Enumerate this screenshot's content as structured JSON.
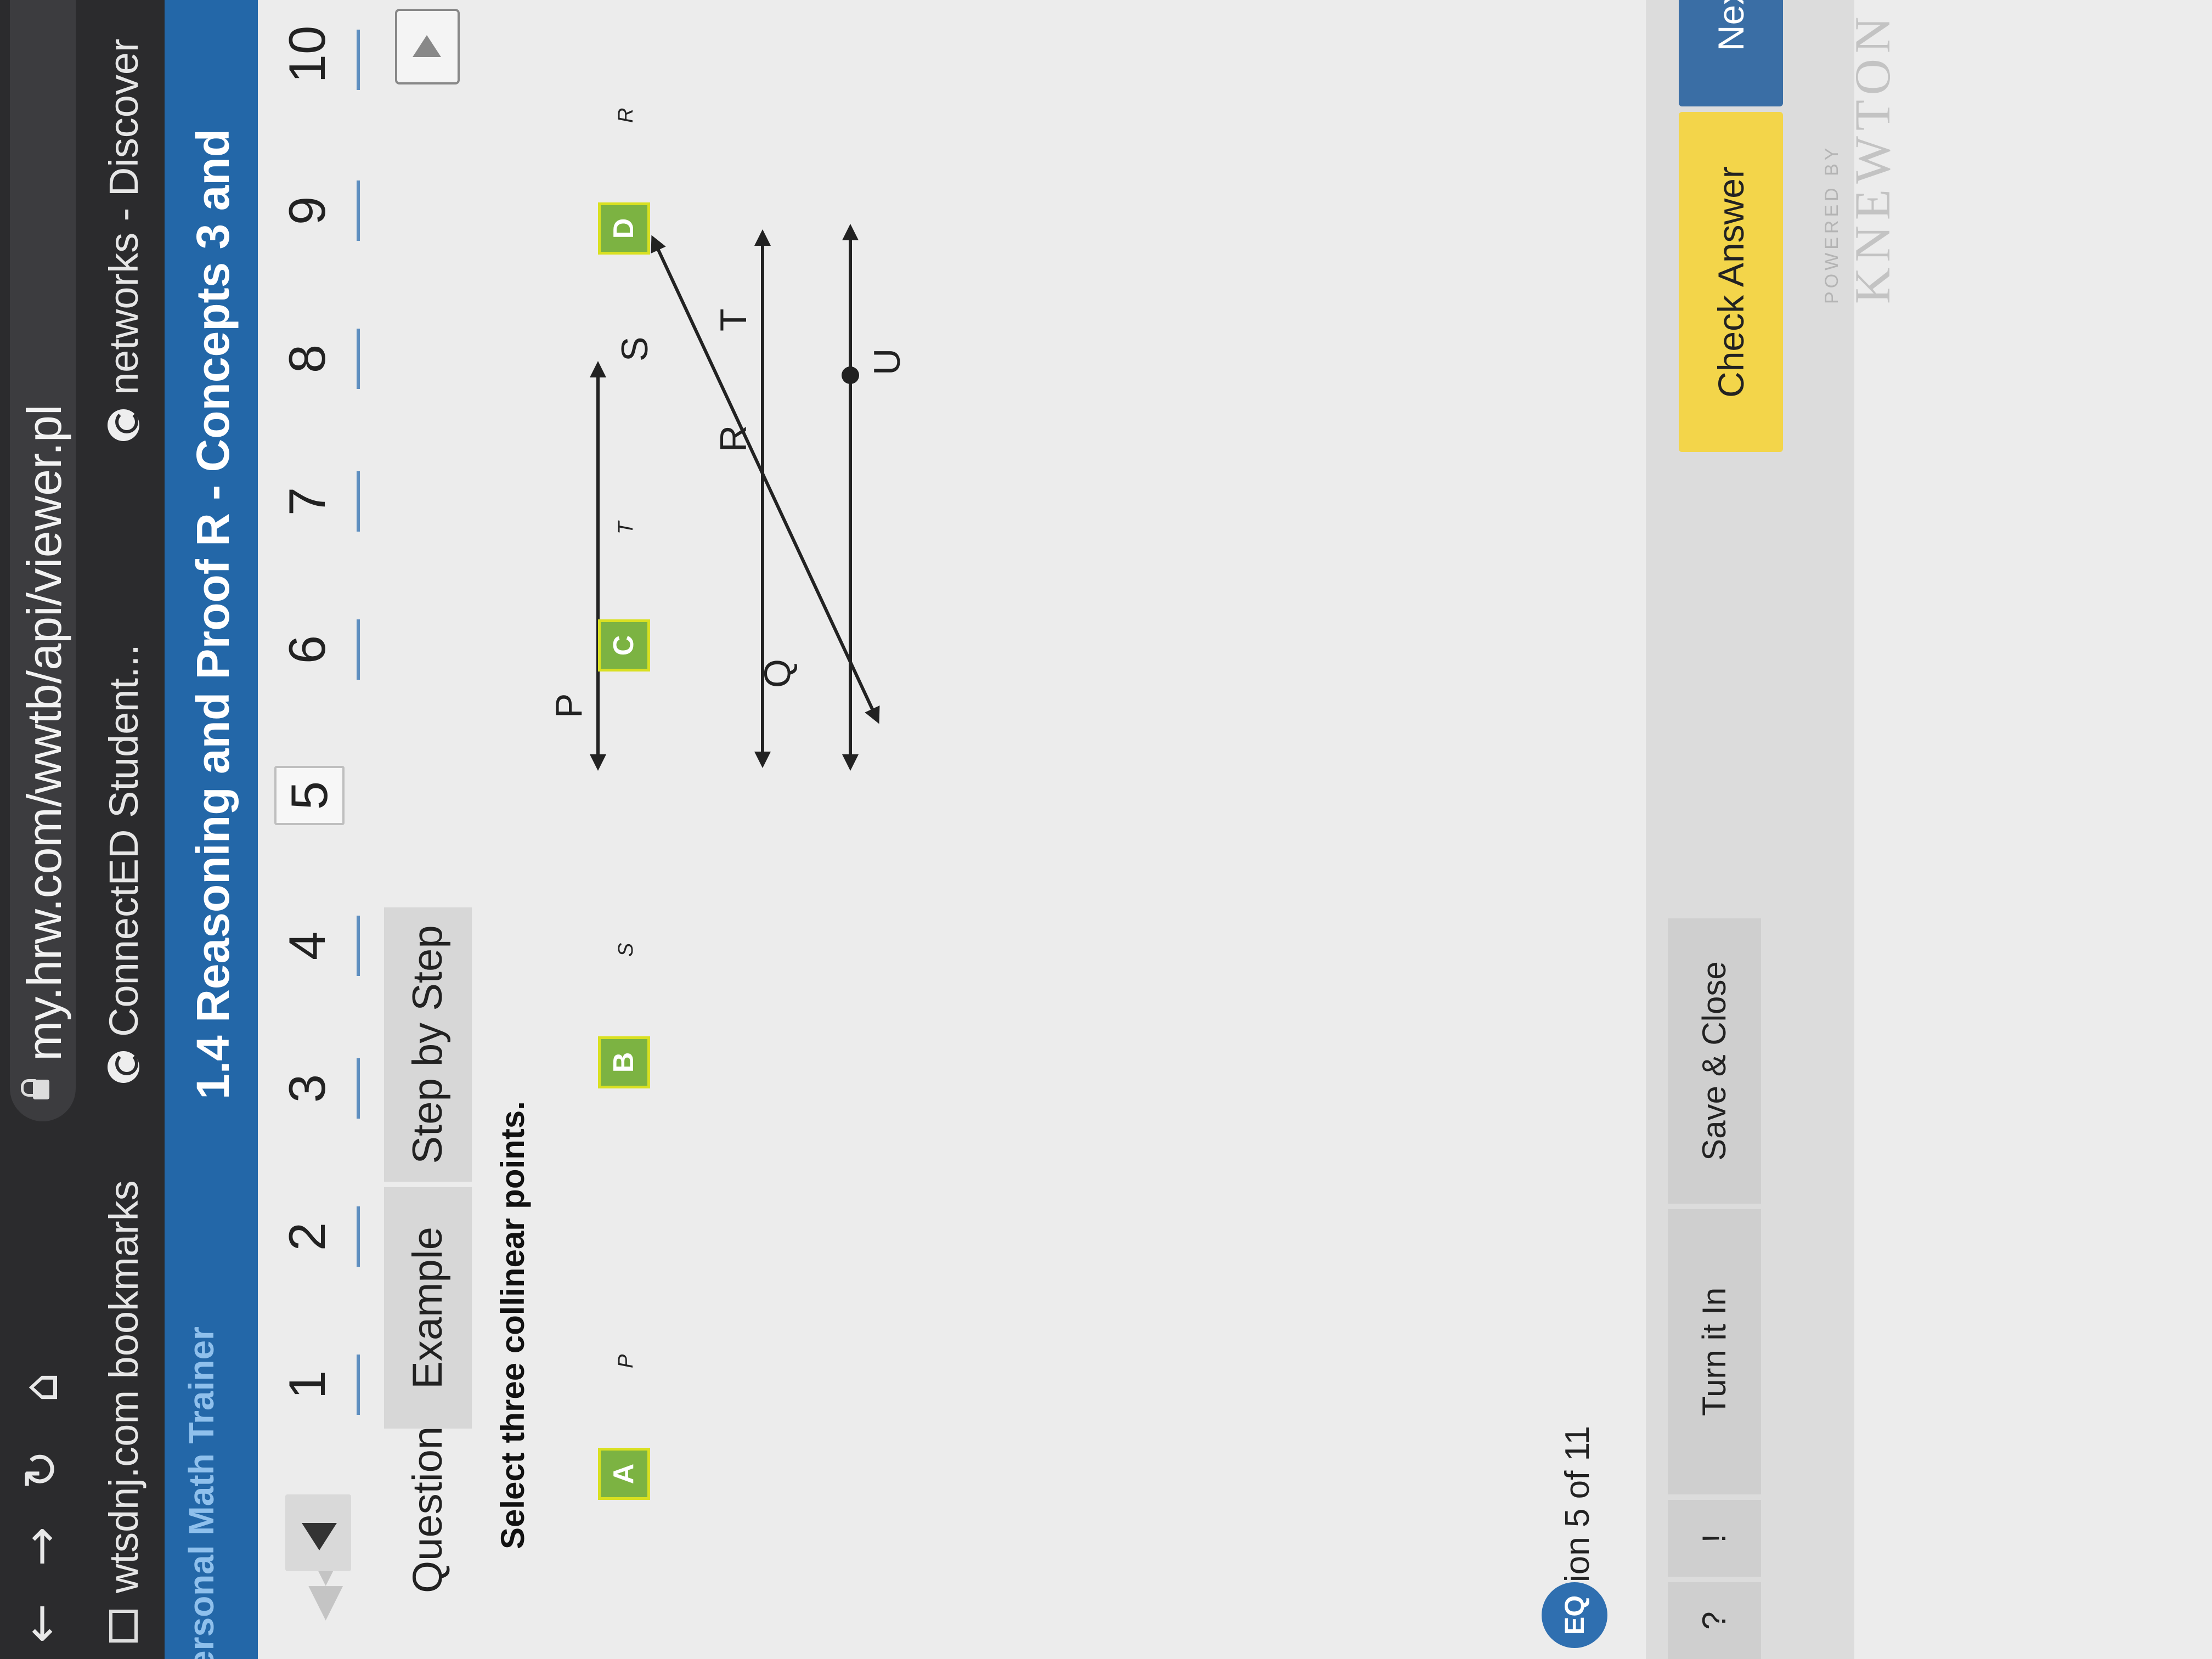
{
  "browser": {
    "url": "my.hrw.com/wwtb/api/viewer.pl",
    "bookmarks": [
      {
        "label": "wtsdnj.com bookmarks"
      },
      {
        "label": "ConnectED Student..."
      },
      {
        "label": "networks - Discover"
      }
    ],
    "nav_icons": [
      "back-arrow-icon",
      "forward-arrow-icon",
      "reload-icon",
      "home-icon",
      "lock-icon"
    ]
  },
  "header": {
    "app_name": "ersonal Math Trainer",
    "lesson_title": "1.4 Reasoning and Proof R - Concepts 3 and"
  },
  "question_nav": {
    "numbers": [
      "1",
      "2",
      "3",
      "4",
      "5",
      "6",
      "7",
      "8",
      "9",
      "10"
    ],
    "active": "5"
  },
  "tabs": [
    {
      "label": "Question"
    },
    {
      "label": "Example"
    },
    {
      "label": "Step by Step"
    }
  ],
  "prompt": "Select three collinear points.",
  "diagram": {
    "point_labels": [
      "P",
      "Q",
      "R",
      "S",
      "T",
      "U"
    ]
  },
  "options": [
    {
      "letter": "A",
      "value": "P"
    },
    {
      "letter": "B",
      "value": "S"
    },
    {
      "letter": "C",
      "value": "T"
    },
    {
      "letter": "D",
      "value": "R"
    }
  ],
  "footer": {
    "question_count": "ion 5 of 11",
    "help_label": "?",
    "alert_label": "!",
    "turn_in": "Turn it In",
    "save_close": "Save & Close",
    "check_answer": "Check Answer",
    "next_question": "Next Question",
    "powered_by": "POWERED BY",
    "brand": "KNEWTON"
  },
  "colors": {
    "header_blue": "#2367a8",
    "option_green": "#7cb342",
    "check_yellow": "#f3d54a",
    "next_blue": "#3a6ea5"
  }
}
